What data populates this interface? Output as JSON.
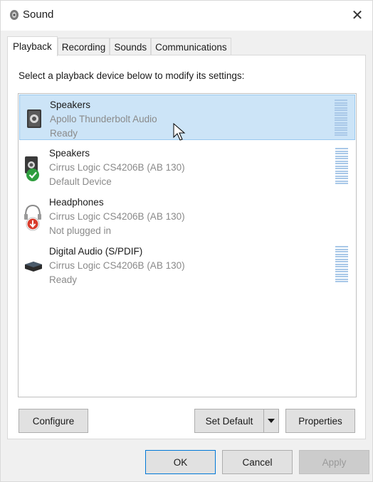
{
  "window": {
    "title": "Sound",
    "close_label": "✕",
    "title_icon": "speaker-icon"
  },
  "tabs": [
    {
      "label": "Playback",
      "active": true
    },
    {
      "label": "Recording",
      "active": false
    },
    {
      "label": "Sounds",
      "active": false
    },
    {
      "label": "Communications",
      "active": false
    }
  ],
  "instruction": "Select a playback device below to modify its settings:",
  "devices": [
    {
      "name": "Speakers",
      "driver": "Apollo Thunderbolt Audio",
      "status": "Ready",
      "icon": "speaker-icon",
      "selected": true,
      "has_meter": true
    },
    {
      "name": "Speakers",
      "driver": "Cirrus Logic CS4206B (AB 130)",
      "status": "Default Device",
      "icon": "speaker-default-icon",
      "selected": false,
      "has_meter": true
    },
    {
      "name": "Headphones",
      "driver": "Cirrus Logic CS4206B (AB 130)",
      "status": "Not plugged in",
      "icon": "headphones-unplugged-icon",
      "selected": false,
      "has_meter": false
    },
    {
      "name": "Digital Audio (S/PDIF)",
      "driver": "Cirrus Logic CS4206B (AB 130)",
      "status": "Ready",
      "icon": "digital-audio-icon",
      "selected": false,
      "has_meter": true
    }
  ],
  "buttons": {
    "configure": "Configure",
    "set_default": "Set Default",
    "properties": "Properties",
    "ok": "OK",
    "cancel": "Cancel",
    "apply": "Apply"
  },
  "colors": {
    "selection": "#cce4f7",
    "meter": "#a9c8e8",
    "default_check": "#2e9e3e",
    "unplugged": "#d83b2b"
  }
}
